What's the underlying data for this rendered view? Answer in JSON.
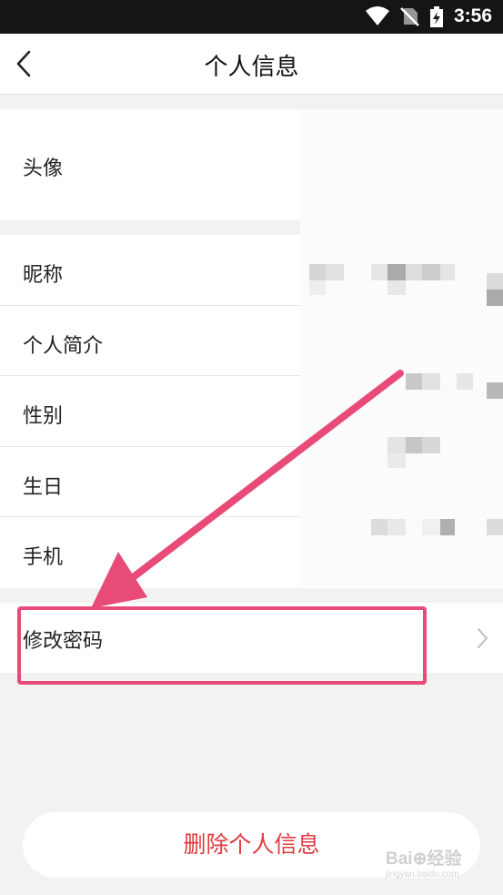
{
  "status_bar": {
    "time": "3:56",
    "icons": [
      "wifi-icon",
      "no-sim-icon",
      "battery-charging-icon"
    ]
  },
  "header": {
    "title": "个人信息",
    "back_icon": "chevron-left-icon"
  },
  "avatar_row": {
    "label": "头像"
  },
  "fields": [
    {
      "label": "昵称"
    },
    {
      "label": "个人简介"
    },
    {
      "label": "性别"
    },
    {
      "label": "生日"
    },
    {
      "label": "手机"
    }
  ],
  "password_row": {
    "label": "修改密码",
    "icon": "chevron-right-icon"
  },
  "delete_button": {
    "label": "删除个人信息",
    "color": "#e0393e"
  },
  "annotation": {
    "color": "#e84b78"
  },
  "watermark": {
    "text": "Bai⊕经验",
    "sub": "jingyan.baidu.com"
  }
}
